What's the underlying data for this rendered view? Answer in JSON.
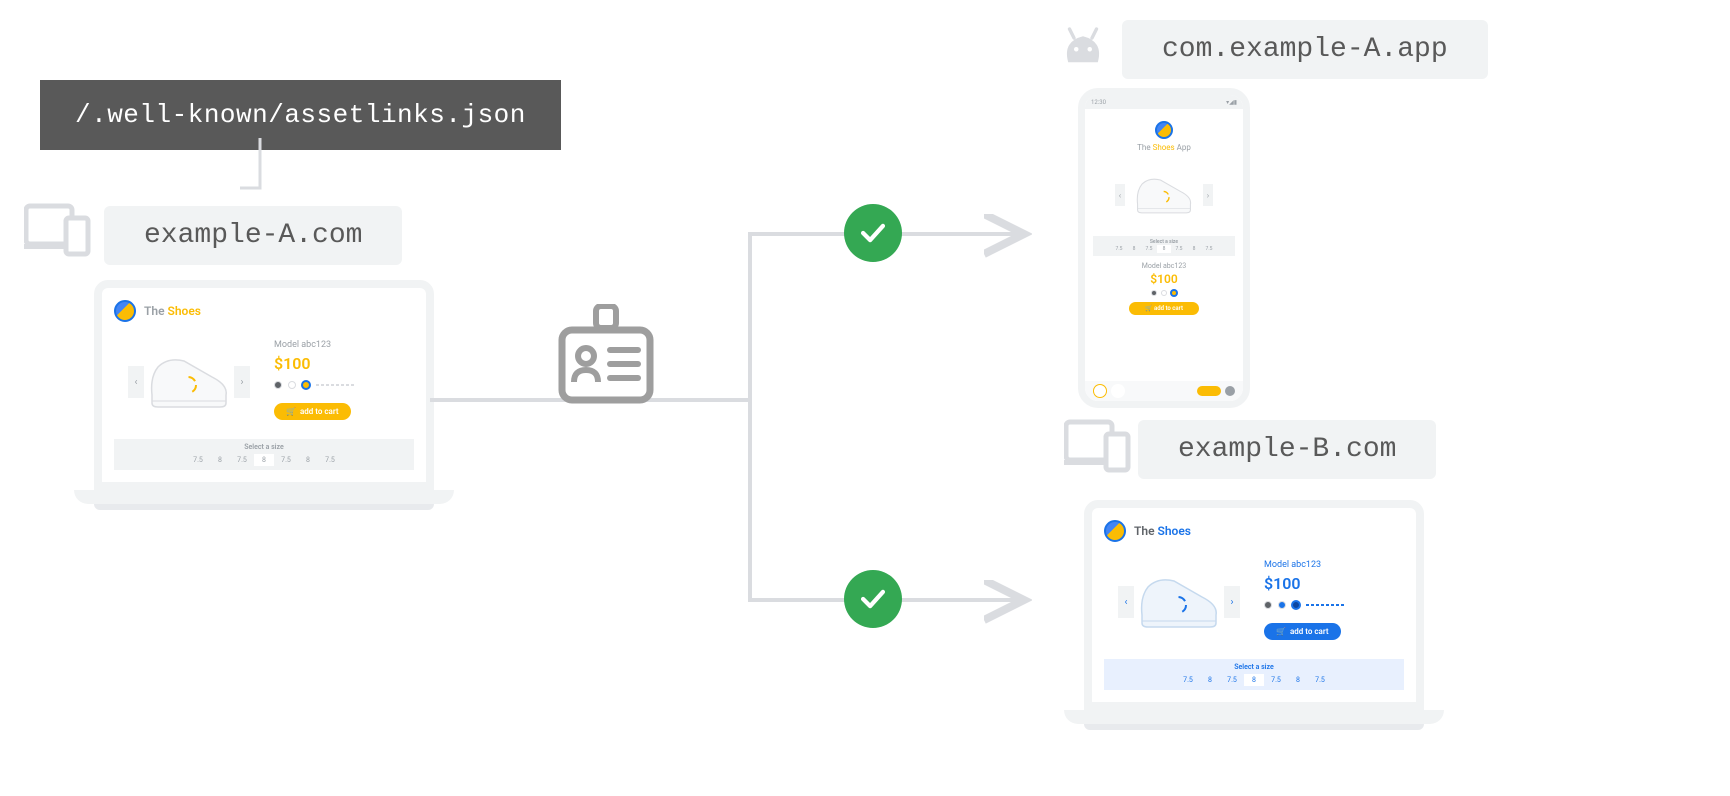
{
  "assetlinks": "/.well-known/assetlinks.json",
  "domain_a": "example-A.com",
  "package_name": "com.example-A.app",
  "domain_b": "example-B.com",
  "shop": {
    "brand_the": "The",
    "brand_shoes": "Shoes",
    "brand_app": "App",
    "model": "Model abc123",
    "price": "$100",
    "cart_label": "add to cart",
    "size_label": "Select a size",
    "sizes": [
      "7.5",
      "8",
      "7.5",
      "8",
      "7.5",
      "8",
      "7.5"
    ]
  },
  "phone": {
    "time": "12:30"
  }
}
